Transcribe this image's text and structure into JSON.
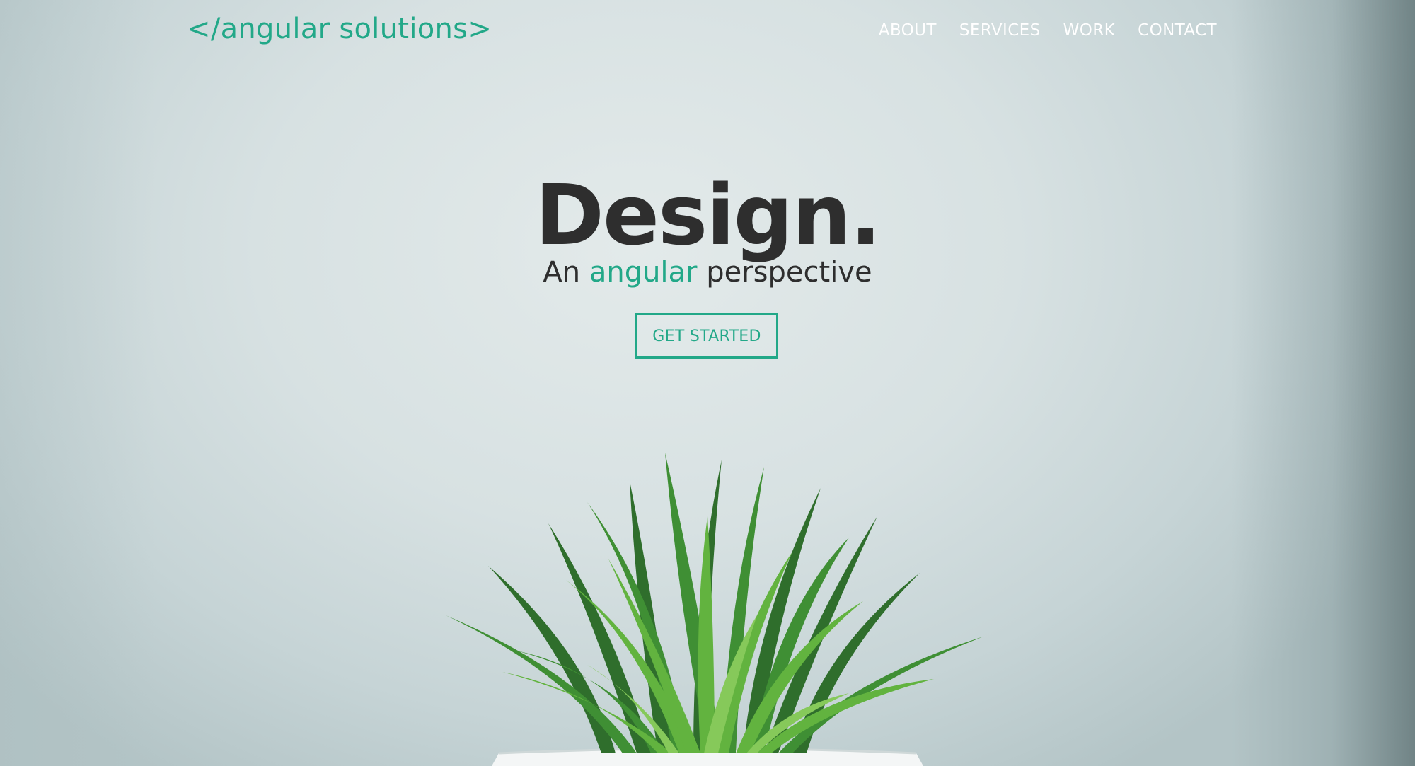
{
  "header": {
    "logo_text": "</angular solutions>",
    "nav": [
      {
        "label": "ABOUT"
      },
      {
        "label": "SERVICES"
      },
      {
        "label": "WORK"
      },
      {
        "label": "CONTACT"
      }
    ]
  },
  "hero": {
    "headline": "Design.",
    "subline_prefix": "An",
    "subline_accent": "angular",
    "subline_suffix": "perspective",
    "cta_label": "GET STARTED",
    "background_image": "potted-grass-photo"
  },
  "colors": {
    "accent": "#22a888",
    "text_dark": "#2e2e2e",
    "nav_text": "#ffffff",
    "background": "#d9e3e4"
  }
}
